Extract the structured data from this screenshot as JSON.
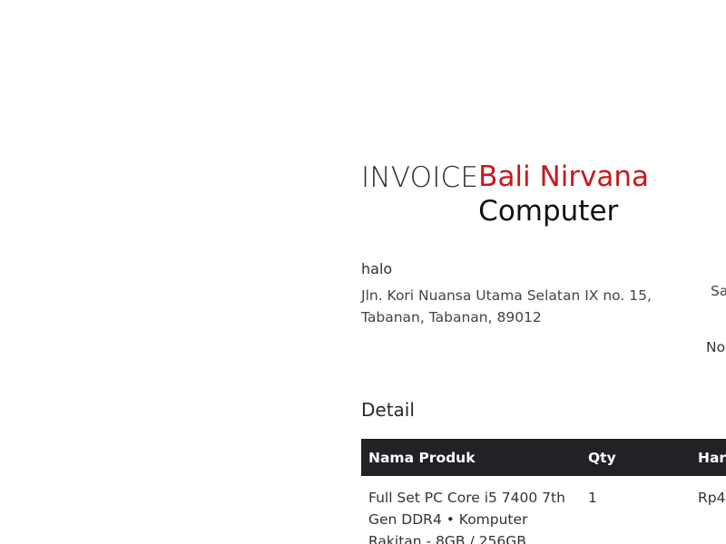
{
  "header": {
    "invoice_label": "INVOICE",
    "company_line1": "Bali Nirvana",
    "company_line2": "Computer",
    "brand_color": "#c8181d"
  },
  "customer": {
    "name": "halo",
    "address": "Jln. Kori Nuansa Utama Selatan IX no. 15, Tabanan, Tabanan, 89012"
  },
  "side_info": {
    "label_1": "Sa",
    "label_2": "No"
  },
  "detail": {
    "heading": "Detail",
    "columns": [
      "Nama Produk",
      "Qty",
      "Har"
    ],
    "rows": [
      {
        "product": "Full Set PC Core i5 7400 7th Gen DDR4 • Komputer Rakitan - 8GB / 256GB",
        "qty": "1",
        "price": "Rp4"
      }
    ]
  }
}
